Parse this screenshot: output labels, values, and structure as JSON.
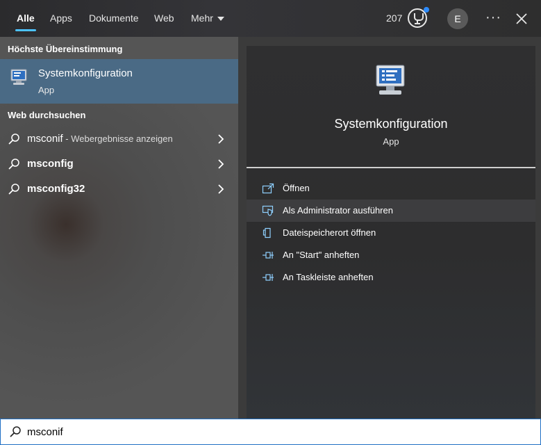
{
  "tabs": [
    {
      "label": "Alle",
      "active": true
    },
    {
      "label": "Apps",
      "active": false
    },
    {
      "label": "Dokumente",
      "active": false
    },
    {
      "label": "Web",
      "active": false
    },
    {
      "label": "Mehr",
      "active": false
    }
  ],
  "header": {
    "points": "207",
    "avatar_initial": "E",
    "more_label": "···",
    "icons": [
      "rewards-trophy-icon",
      "notification-dot",
      "close-icon",
      "more-icon"
    ]
  },
  "best_match": {
    "section_title": "Höchste Übereinstimmung",
    "title": "Systemkonfiguration",
    "subtitle": "App"
  },
  "web_search": {
    "section_title": "Web durchsuchen",
    "rows": [
      {
        "term": "msconif",
        "hint": " - Webergebnisse anzeigen"
      },
      {
        "term": "msconfig",
        "hint": ""
      },
      {
        "term": "msconfig32",
        "hint": ""
      }
    ]
  },
  "detail": {
    "title": "Systemkonfiguration",
    "subtitle": "App",
    "actions": [
      {
        "label": "Öffnen",
        "icon": "open-icon"
      },
      {
        "label": "Als Administrator ausführen",
        "icon": "shield-icon"
      },
      {
        "label": "Dateispeicherort öffnen",
        "icon": "file-location-icon"
      },
      {
        "label": "An \"Start\" anheften",
        "icon": "pin-icon"
      },
      {
        "label": "An Taskleiste anheften",
        "icon": "pin-icon"
      }
    ]
  },
  "search": {
    "value": "msconif"
  },
  "colors": {
    "accent": "#4cc2ff",
    "selection": "#4a6a85",
    "search_border": "#1f6fc4"
  }
}
